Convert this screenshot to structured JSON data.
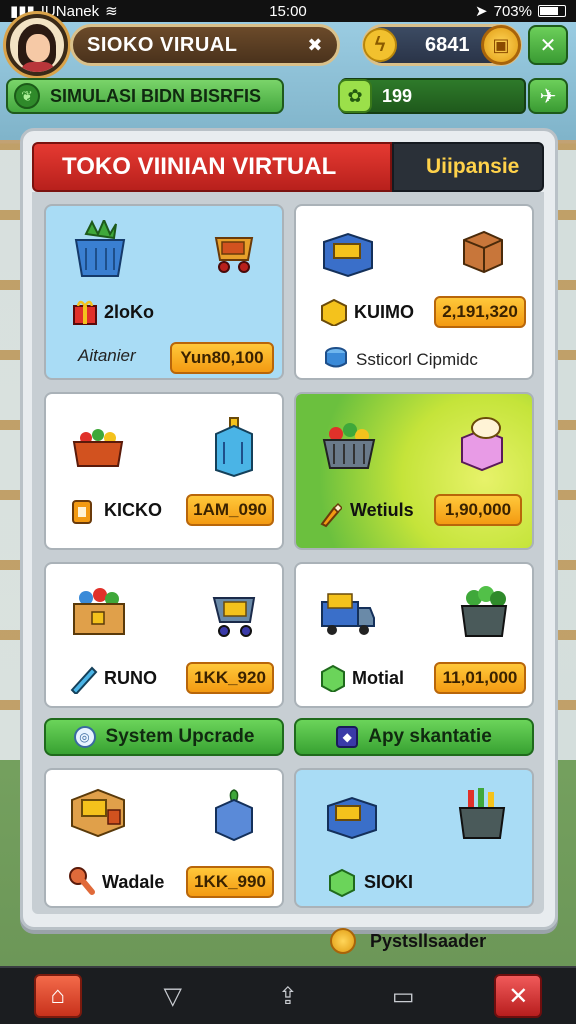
{
  "status_bar": {
    "carrier": "IUNanek",
    "time": "15:00",
    "battery": "703%"
  },
  "hud": {
    "store_name": "SIOKO VIRUAL",
    "coins": "6841",
    "banner": "SIMULASI BIDN BISRFIS",
    "cash": "199"
  },
  "panel": {
    "title": "TOKO VIINIAN VIRTUAL",
    "tab": "Uiipansie"
  },
  "cards": [
    {
      "name": "2loKo",
      "sub": "Aitanier",
      "price": "Yun80,100"
    },
    {
      "name": "KUIMO",
      "sub": "Ssticorl Cipmidc",
      "price": "2,191,320"
    },
    {
      "name": "KICKO",
      "sub": "",
      "price": "1AM_090"
    },
    {
      "name": "Wetiuls",
      "sub": "",
      "price": "1,90,000"
    },
    {
      "name": "RUNO",
      "sub": "",
      "price": "1KK_920"
    },
    {
      "name": "Motial",
      "sub": "",
      "price": "11,01,000"
    },
    {
      "name": "Wadale",
      "sub": "",
      "price": "1KK_990"
    },
    {
      "name": "SIOKI",
      "sub": "",
      "price": ""
    }
  ],
  "buttons": {
    "system_upgrade": "System Upcrade",
    "apply": "Apy skantatie"
  },
  "footer_text": "Pystsllsaader",
  "colors": {
    "title_red": "#d92a24",
    "price_orange": "#f5a623",
    "button_green": "#4cba3f",
    "card_blue": "#a9dcf5"
  }
}
